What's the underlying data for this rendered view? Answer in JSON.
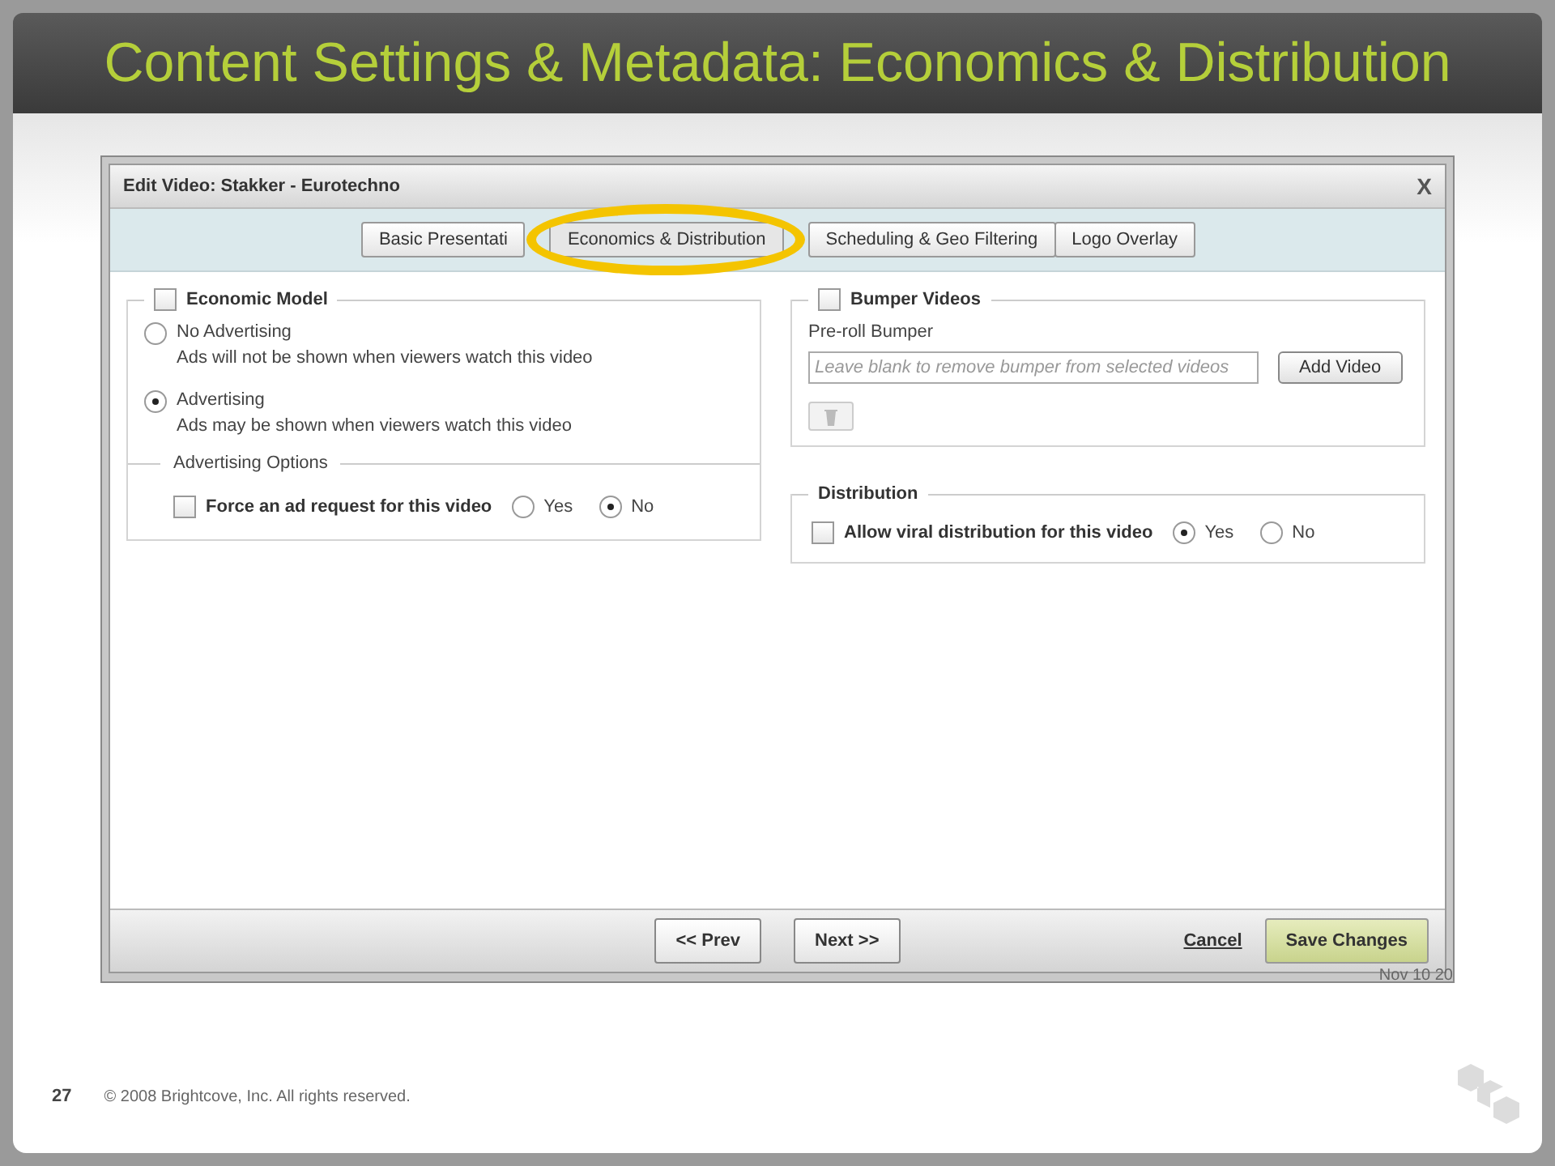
{
  "slide": {
    "title": "Content Settings & Metadata: Economics & Distribution",
    "page_number": "27",
    "copyright": "© 2008 Brightcove, Inc. All rights reserved.",
    "background_date": "Nov 10 20"
  },
  "dialog": {
    "title": "Edit Video: Stakker - Eurotechno",
    "close": "X",
    "tabs": [
      {
        "label": "Basic Presentati",
        "selected": false
      },
      {
        "label": "Economics & Distribution",
        "selected": true,
        "highlighted": true
      },
      {
        "label": "Scheduling & Geo Filtering",
        "selected": false
      },
      {
        "label": "Logo Overlay",
        "selected": false
      }
    ],
    "economic_model": {
      "label": "Economic Model",
      "checked": false,
      "options": [
        {
          "label": "No Advertising",
          "description": "Ads will not be shown when viewers watch this video",
          "selected": false
        },
        {
          "label": "Advertising",
          "description": "Ads may be shown when viewers watch this video",
          "selected": true
        }
      ],
      "advertising_options": {
        "label": "Advertising Options",
        "force_ad": {
          "label": "Force an ad request for this video",
          "checked": false,
          "choices": [
            {
              "label": "Yes",
              "selected": false
            },
            {
              "label": "No",
              "selected": true
            }
          ]
        }
      }
    },
    "bumper_videos": {
      "label": "Bumper Videos",
      "checked": false,
      "field_label": "Pre-roll Bumper",
      "placeholder": "Leave blank to remove bumper from selected videos",
      "add_button": "Add Video"
    },
    "distribution": {
      "label": "Distribution",
      "viral": {
        "label": "Allow viral distribution for this video",
        "checked": false,
        "choices": [
          {
            "label": "Yes",
            "selected": true
          },
          {
            "label": "No",
            "selected": false
          }
        ]
      }
    },
    "footer": {
      "prev": "<< Prev",
      "next": "Next >>",
      "cancel": "Cancel",
      "save": "Save Changes"
    }
  }
}
